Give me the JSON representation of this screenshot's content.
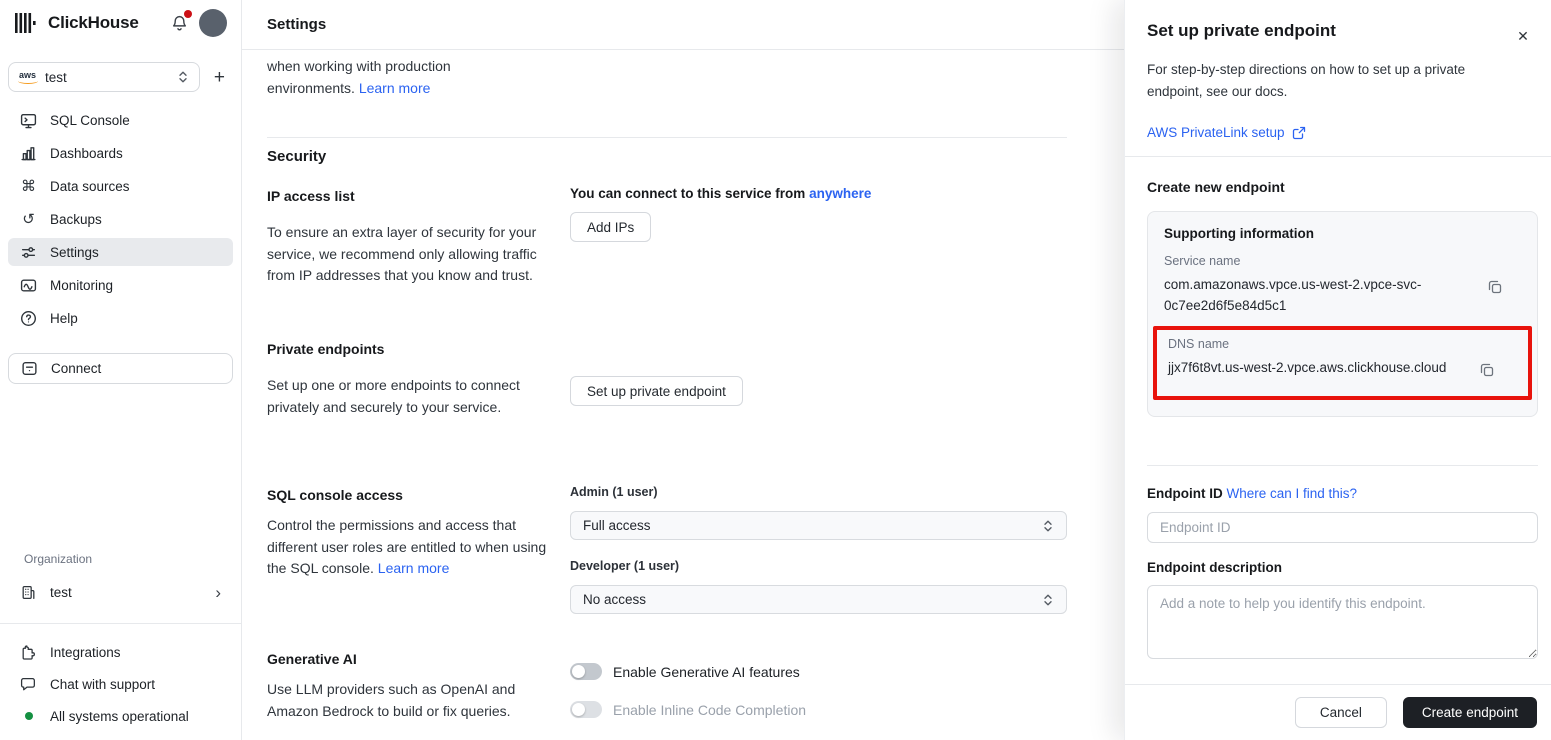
{
  "glyphs": {
    "plus": "+",
    "chevron_right": "›",
    "close": "✕",
    "command": "⌘",
    "history": "↺"
  },
  "colors": {
    "accent_blue": "#2b63f1",
    "highlight_red": "#e8130c",
    "status_green": "#149041",
    "notification_red": "#cc1016",
    "dark_button": "#1d2025"
  },
  "sidebar": {
    "brand": "ClickHouse",
    "service_switcher": {
      "provider": "aws",
      "value": "test"
    },
    "nav": [
      {
        "label": "SQL Console"
      },
      {
        "label": "Dashboards"
      },
      {
        "label": "Data sources"
      },
      {
        "label": "Backups"
      },
      {
        "label": "Settings"
      },
      {
        "label": "Monitoring"
      },
      {
        "label": "Help"
      }
    ],
    "connect_label": "Connect",
    "organization_label": "Organization",
    "organization_name": "test",
    "footer": [
      {
        "label": "Integrations"
      },
      {
        "label": "Chat with support"
      },
      {
        "label": "All systems operational"
      }
    ]
  },
  "main": {
    "header_title": "Settings",
    "intro": {
      "line1": "when working with production",
      "line2": "environments.",
      "link": "Learn more"
    },
    "security": {
      "heading": "Security",
      "ip": {
        "title": "IP access list",
        "description": "To ensure an extra layer of security for your service, we recommend only allowing traffic from IP addresses that you know and trust.",
        "connect_prefix": "You can connect to this service from",
        "connect_link": "anywhere",
        "add_button": "Add IPs"
      },
      "private_endpoints": {
        "title": "Private endpoints",
        "description": "Set up one or more endpoints to connect privately and securely to your service.",
        "button": "Set up private endpoint"
      }
    },
    "sql_access": {
      "title": "SQL console access",
      "description": "Control the permissions and access that different user roles are entitled to when using the SQL console.",
      "link": "Learn more",
      "admin_label": "Admin (1 user)",
      "admin_value": "Full access",
      "developer_label": "Developer (1 user)",
      "developer_value": "No access"
    },
    "generative_ai": {
      "title": "Generative AI",
      "description": "Use LLM providers such as OpenAI and Amazon Bedrock to build or fix queries.",
      "toggle_generative": "Enable Generative AI features",
      "toggle_inline": "Enable Inline Code Completion"
    }
  },
  "panel": {
    "title": "Set up private endpoint",
    "description": "For step-by-step directions on how to set up a private endpoint, see our docs.",
    "docs_link": "AWS PrivateLink setup",
    "create_heading": "Create new endpoint",
    "card": {
      "title": "Supporting information",
      "service_name_label": "Service name",
      "service_name": "com.amazonaws.vpce.us-west-2.vpce-svc-0c7ee2d6f5e84d5c1",
      "dns_name_label": "DNS name",
      "dns_name": "jjx7f6t8vt.us-west-2.vpce.aws.clickhouse.cloud"
    },
    "endpoint_id_label": "Endpoint ID",
    "endpoint_id_link": "Where can I find this?",
    "endpoint_id_placeholder": "Endpoint ID",
    "endpoint_description_label": "Endpoint description",
    "endpoint_description_placeholder": "Add a note to help you identify this endpoint.",
    "cancel_button": "Cancel",
    "create_button": "Create endpoint"
  }
}
